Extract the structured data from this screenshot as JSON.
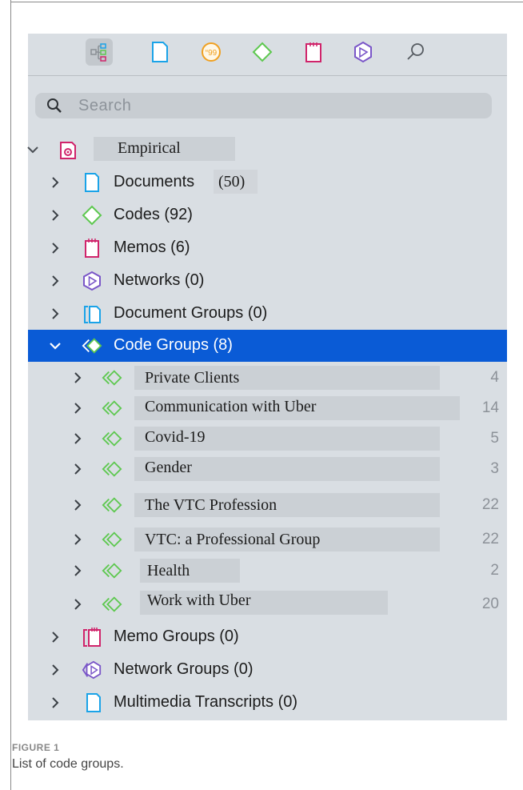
{
  "toolbar": {
    "buttons": [
      {
        "name": "project-explorer-icon",
        "active": true
      },
      {
        "name": "document-icon"
      },
      {
        "name": "quotation-icon"
      },
      {
        "name": "code-icon"
      },
      {
        "name": "memo-icon"
      },
      {
        "name": "network-icon"
      },
      {
        "name": "search-icon"
      }
    ]
  },
  "search": {
    "placeholder": "Search"
  },
  "tree": {
    "root": {
      "label": "Empirical"
    },
    "items": [
      {
        "label": "Documents",
        "count": "(50)"
      },
      {
        "label": "Codes (92)"
      },
      {
        "label": "Memos (6)"
      },
      {
        "label": "Networks (0)"
      },
      {
        "label": "Document Groups (0)"
      },
      {
        "label": "Code Groups (8)",
        "selected": true
      }
    ],
    "code_groups": [
      {
        "label": "Private Clients",
        "count": "4"
      },
      {
        "label": "Communication with Uber",
        "count": "14"
      },
      {
        "label": "Covid-19",
        "count": "5"
      },
      {
        "label": "Gender",
        "count": "3"
      },
      {
        "label": "The VTC Profession",
        "count": "22"
      },
      {
        "label": "VTC: a Professional Group",
        "count": "22"
      },
      {
        "label": "Health",
        "count": "2"
      },
      {
        "label": "Work with Uber",
        "count": "20"
      }
    ],
    "bottom": [
      {
        "label": "Memo Groups (0)"
      },
      {
        "label": "Network Groups (0)"
      },
      {
        "label": "Multimedia Transcripts (0)"
      }
    ]
  },
  "caption": {
    "figure": "FIGURE 1",
    "text": "List of code groups."
  },
  "colors": {
    "selection": "#0a5bd6",
    "code_green": "#5ec850",
    "memo_red": "#d0246b",
    "doc_blue": "#1aa3e8",
    "network_purple": "#7a56c8",
    "quotation_orange": "#f0a020",
    "panel": "#d9dee3"
  }
}
